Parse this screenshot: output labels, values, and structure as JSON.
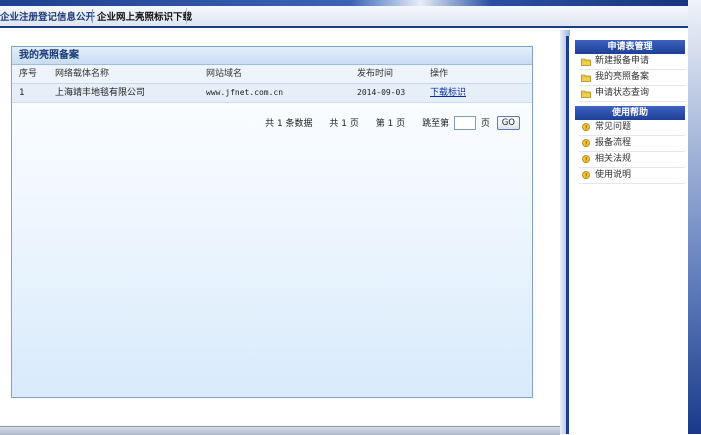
{
  "tabs": {
    "public_info": "企业注册登记信息公开",
    "download": "企业网上亮照标识下载"
  },
  "panel": {
    "title": "我的亮照备案",
    "columns": [
      "序号",
      "网络载体名称",
      "网站域名",
      "发布时间",
      "操作"
    ],
    "rows": [
      {
        "index": "1",
        "name": "上海靖丰地毯有限公司",
        "domain": "www.jfnet.com.cn",
        "date": "2014-09-03",
        "action": "下载标识"
      }
    ]
  },
  "pager": {
    "total": "共 1 条数据",
    "pages": "共 1 页",
    "current": "第 1 页",
    "jump_label": "跳至第",
    "jump_unit": "页",
    "go": "GO"
  },
  "sidebar": {
    "section_apply": "申请表管理",
    "apply_items": [
      {
        "label": "新建报备申请",
        "icon": "folder-icon"
      },
      {
        "label": "我的亮照备案",
        "icon": "folder-icon"
      },
      {
        "label": "申请状态查询",
        "icon": "folder-icon"
      }
    ],
    "section_help": "使用帮助",
    "help_items": [
      {
        "label": "常见问题",
        "icon": "help-bulb-icon"
      },
      {
        "label": "报备流程",
        "icon": "help-bulb-icon"
      },
      {
        "label": "相关法规",
        "icon": "help-bulb-icon"
      },
      {
        "label": "使用说明",
        "icon": "help-bulb-icon"
      }
    ]
  },
  "colors": {
    "accent": "#1c3c8c",
    "panel_border": "#7fa2cc",
    "link": "#0a2ea0"
  }
}
